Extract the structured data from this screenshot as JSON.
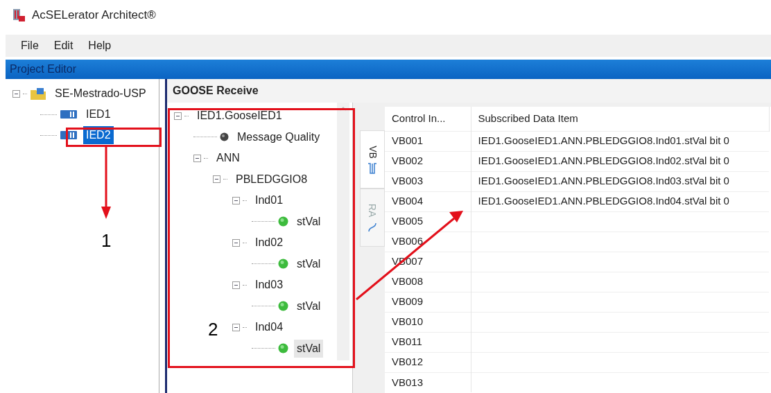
{
  "window": {
    "title": "AcSELerator Architect®"
  },
  "menu": [
    "File",
    "Edit",
    "Help"
  ],
  "panel_title": "Project Editor",
  "project_tree": [
    {
      "label": "SE-Mestrado-USP",
      "kind": "project",
      "expanded": true,
      "selected": false,
      "children": [
        {
          "label": "IED1",
          "kind": "device",
          "selected": false
        },
        {
          "label": "IED2",
          "kind": "device",
          "selected": true
        }
      ]
    }
  ],
  "section_title": "GOOSE Receive",
  "goose_tree": [
    {
      "label": "IED1.GooseIED1",
      "expanded": true,
      "selected": false,
      "children": [
        {
          "label": "Message Quality",
          "kind": "quality",
          "selected": false
        },
        {
          "label": "ANN",
          "expanded": true,
          "selected": false,
          "children": [
            {
              "label": "PBLEDGGIO8",
              "expanded": true,
              "selected": false,
              "children": [
                {
                  "label": "Ind01",
                  "expanded": true,
                  "selected": false,
                  "children": [
                    {
                      "label": "stVal",
                      "kind": "attribute",
                      "selected": false
                    }
                  ]
                },
                {
                  "label": "Ind02",
                  "expanded": true,
                  "selected": false,
                  "children": [
                    {
                      "label": "stVal",
                      "kind": "attribute",
                      "selected": false
                    }
                  ]
                },
                {
                  "label": "Ind03",
                  "expanded": true,
                  "selected": false,
                  "children": [
                    {
                      "label": "stVal",
                      "kind": "attribute",
                      "selected": false
                    }
                  ]
                },
                {
                  "label": "Ind04",
                  "expanded": true,
                  "selected": false,
                  "children": [
                    {
                      "label": "stVal",
                      "kind": "attribute",
                      "selected": true
                    }
                  ]
                }
              ]
            }
          ]
        }
      ]
    }
  ],
  "side_tabs": [
    {
      "label": "VB",
      "kind": "pulse",
      "selected": true
    },
    {
      "label": "RA",
      "kind": "wave",
      "selected": false
    }
  ],
  "table": {
    "columns": [
      "Control In...",
      "Subscribed Data Item"
    ],
    "rows": [
      {
        "control": "VB001",
        "item": "IED1.GooseIED1.ANN.PBLEDGGIO8.Ind01.stVal bit 0"
      },
      {
        "control": "VB002",
        "item": "IED1.GooseIED1.ANN.PBLEDGGIO8.Ind02.stVal bit 0"
      },
      {
        "control": "VB003",
        "item": "IED1.GooseIED1.ANN.PBLEDGGIO8.Ind03.stVal bit 0"
      },
      {
        "control": "VB004",
        "item": "IED1.GooseIED1.ANN.PBLEDGGIO8.Ind04.stVal bit 0"
      },
      {
        "control": "VB005"
      },
      {
        "control": "VB006"
      },
      {
        "control": "VB007"
      },
      {
        "control": "VB008"
      },
      {
        "control": "VB009"
      },
      {
        "control": "VB010"
      },
      {
        "control": "VB011"
      },
      {
        "control": "VB012"
      },
      {
        "control": "VB013"
      }
    ]
  },
  "annotations": [
    {
      "label": "1"
    },
    {
      "label": "2"
    }
  ]
}
